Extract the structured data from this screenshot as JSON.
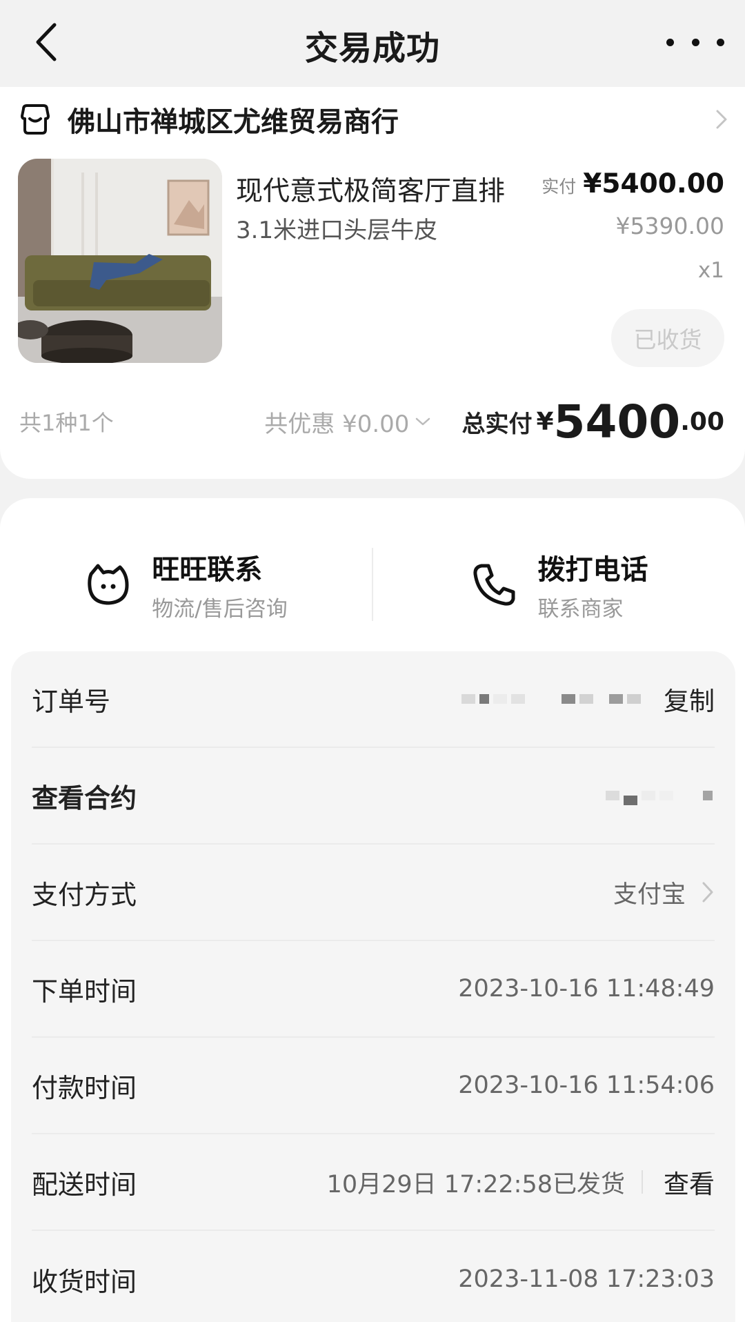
{
  "header": {
    "title": "交易成功"
  },
  "shop": {
    "name": "佛山市禅城区尤维贸易商行"
  },
  "product": {
    "title": "现代意式极简客厅直排",
    "spec": "3.1米进口头层牛皮",
    "paid_label": "实付",
    "paid_value": "¥5400.00",
    "original_price": "¥5390.00",
    "quantity": "x1",
    "status_button": "已收货"
  },
  "summary": {
    "count": "共1种1个",
    "discount": "共优惠 ¥0.00",
    "total_label": "总实付",
    "total_currency": "¥",
    "total_int": "5400",
    "total_dec": ".00"
  },
  "contacts": [
    {
      "title": "旺旺联系",
      "subtitle": "物流/售后咨询"
    },
    {
      "title": "拨打电话",
      "subtitle": "联系商家"
    }
  ],
  "details": [
    {
      "label": "订单号",
      "action": "复制"
    },
    {
      "label": "查看合约"
    },
    {
      "label": "支付方式",
      "value": "支付宝"
    },
    {
      "label": "下单时间",
      "value": "2023-10-16 11:48:49"
    },
    {
      "label": "付款时间",
      "value": "2023-10-16 11:54:06"
    },
    {
      "label": "配送时间",
      "value": "10月29日 17:22:58已发货",
      "action": "查看"
    },
    {
      "label": "收货时间",
      "value": "2023-11-08 17:23:03"
    }
  ],
  "colors": {
    "background": "#f2f2f2",
    "card": "#ffffff",
    "panel": "#f5f5f5",
    "muted": "#999999"
  },
  "icons": [
    "back-arrow-icon",
    "more-dots-icon",
    "shop-icon",
    "chevron-right-icon",
    "chevron-down-icon",
    "wangwang-chat-icon",
    "phone-icon"
  ]
}
